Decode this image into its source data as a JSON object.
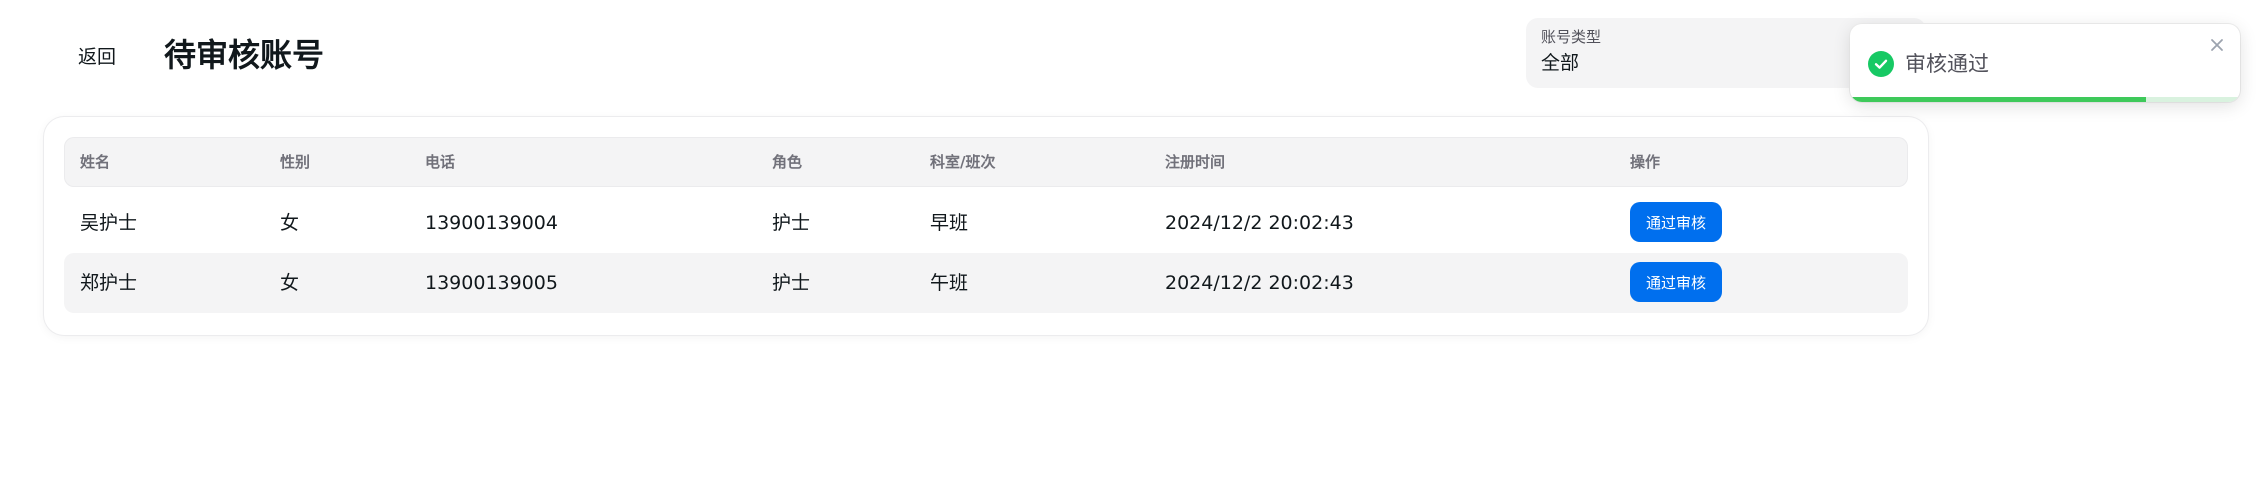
{
  "header": {
    "back_label": "返回",
    "title": "待审核账号"
  },
  "filter": {
    "label": "账号类型",
    "value": "全部"
  },
  "table": {
    "columns": [
      "姓名",
      "性别",
      "电话",
      "角色",
      "科室/班次",
      "注册时间",
      "操作"
    ],
    "rows": [
      {
        "name": "吴护士",
        "gender": "女",
        "phone": "13900139004",
        "role": "护士",
        "dept": "早班",
        "registered": "2024/12/2 20:02:43",
        "action": "通过审核"
      },
      {
        "name": "郑护士",
        "gender": "女",
        "phone": "13900139005",
        "role": "护士",
        "dept": "午班",
        "registered": "2024/12/2 20:02:43",
        "action": "通过审核"
      }
    ]
  },
  "toast": {
    "message": "审核通过",
    "icon": "check-circle-icon",
    "progress": 0.76,
    "color": "#17c964"
  },
  "colors": {
    "primary": "#006fee",
    "success": "#17c964"
  }
}
